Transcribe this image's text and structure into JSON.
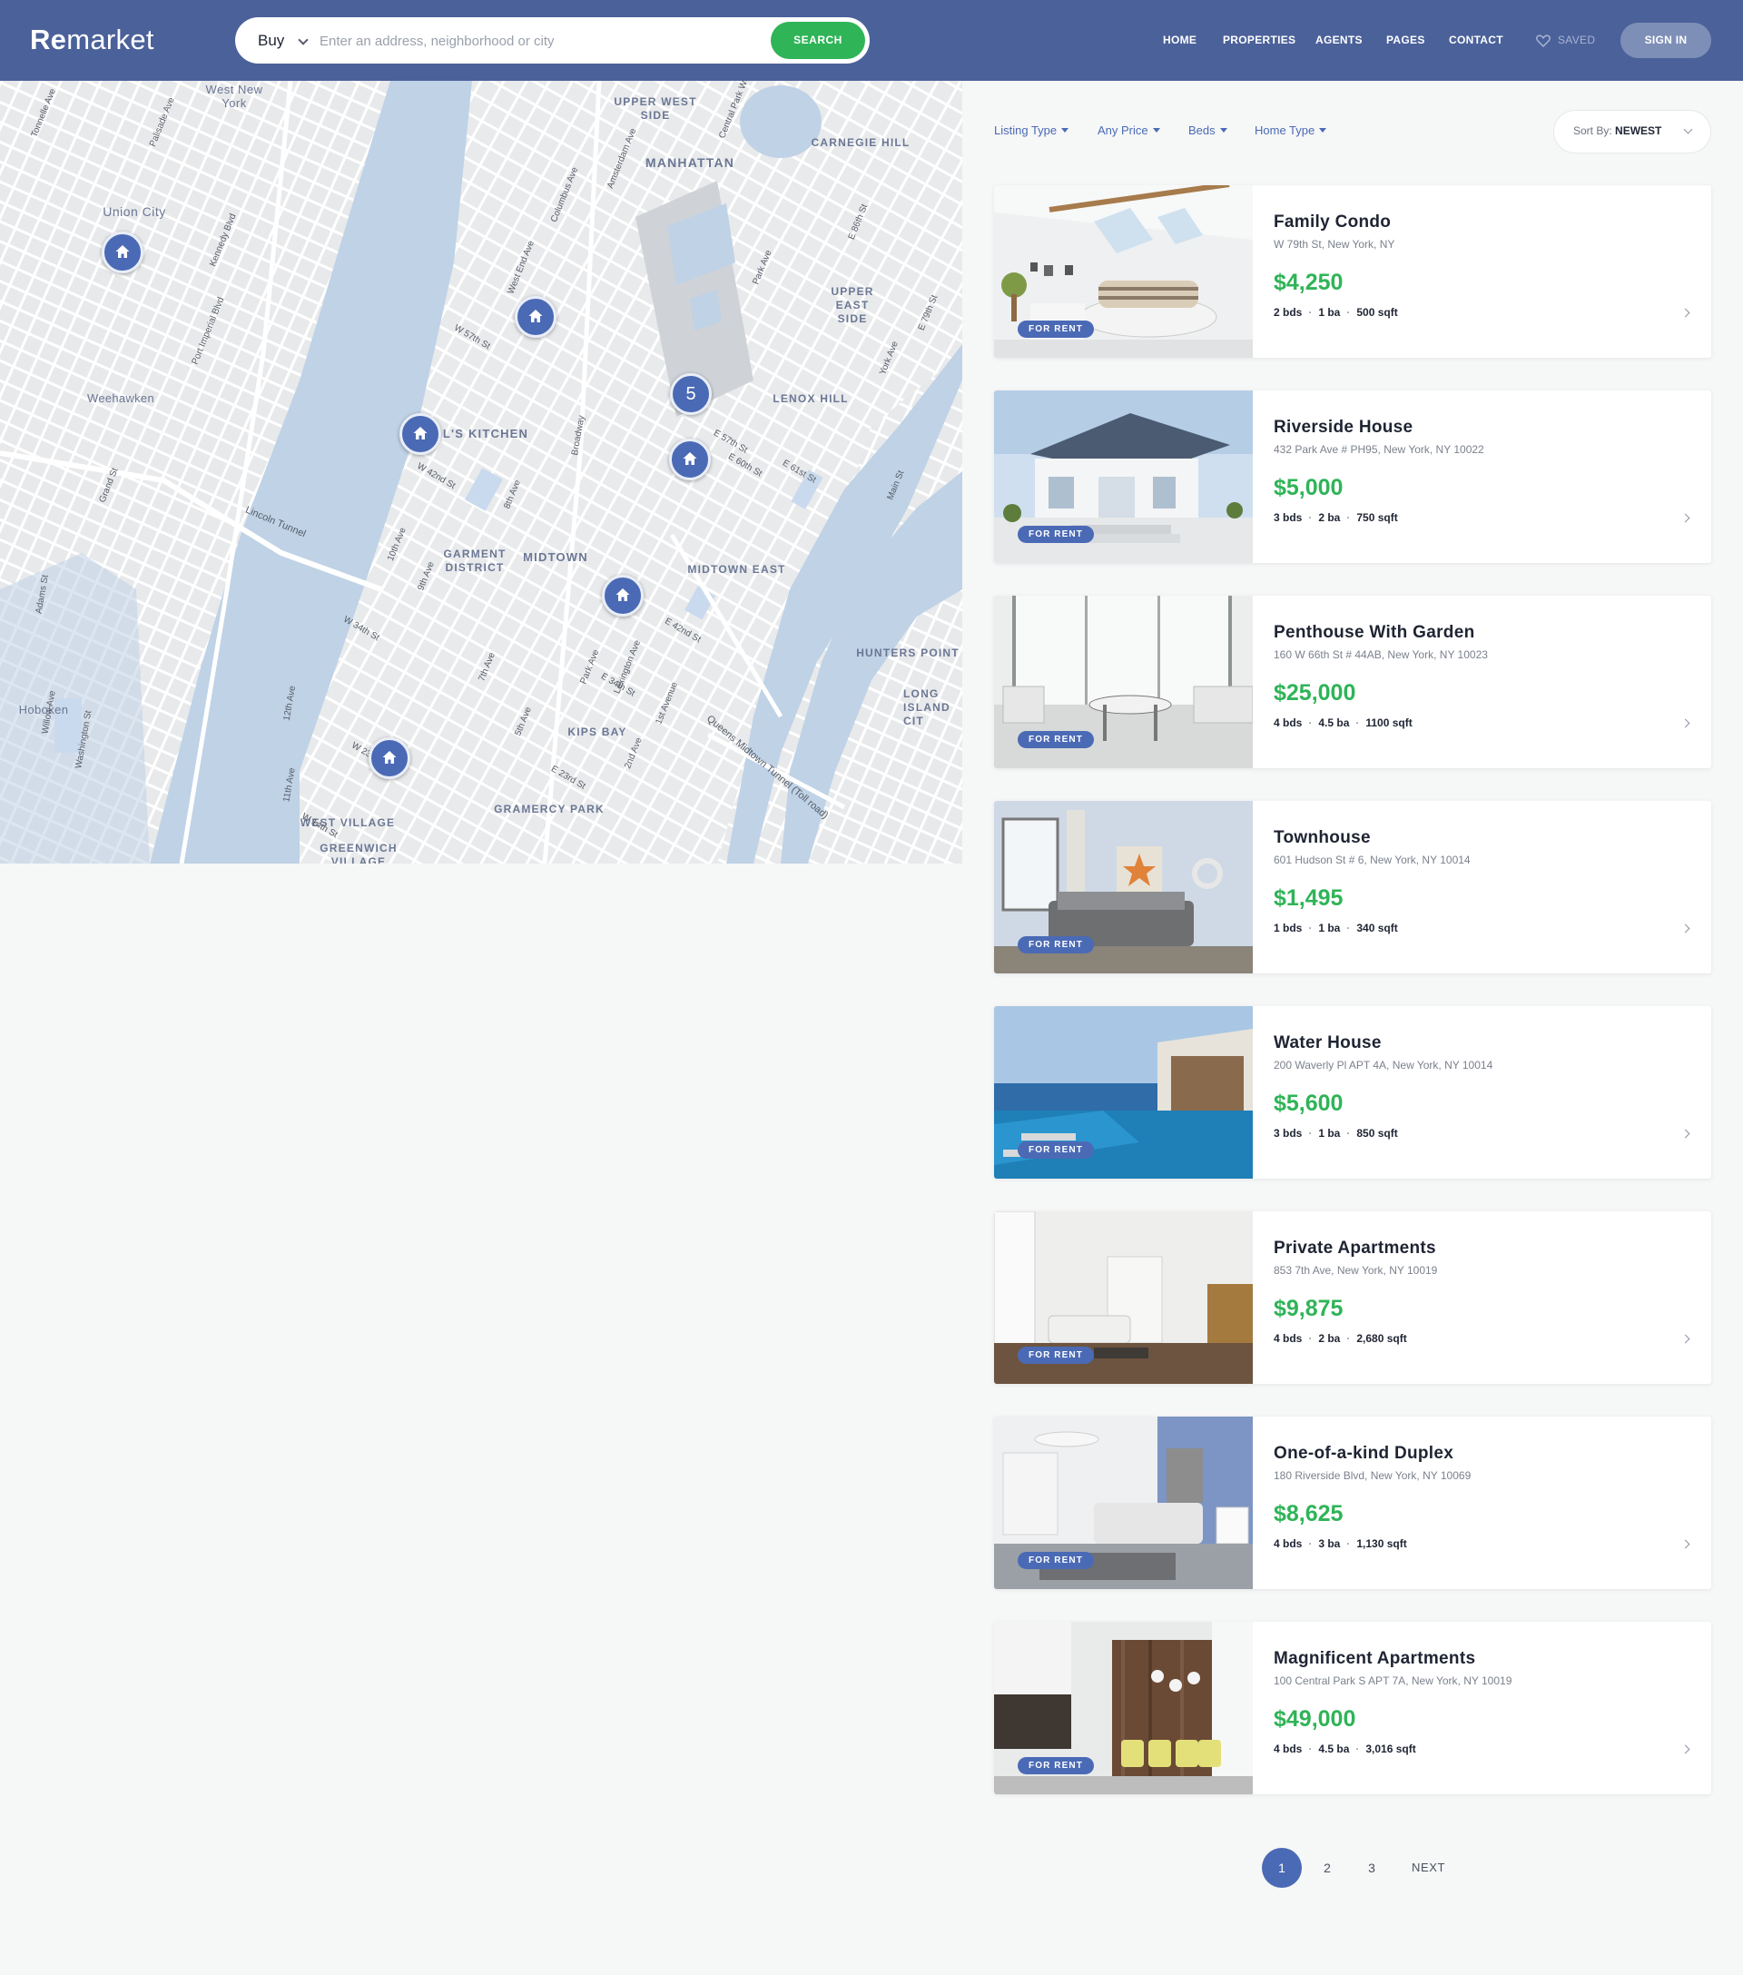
{
  "header": {
    "logo_bold": "Re",
    "logo_rest": "market",
    "search": {
      "type": "Buy",
      "placeholder": "Enter an address, neighborhood or city",
      "button": "SEARCH"
    },
    "nav": [
      "HOME",
      "PROPERTIES",
      "AGENTS",
      "PAGES",
      "CONTACT"
    ],
    "saved": "SAVED",
    "signin": "SIGN IN"
  },
  "map": {
    "neighborhoods": [
      "West New York",
      "UPPER WEST SIDE",
      "MANHATTAN",
      "CARNEGIE HILL",
      "Union City",
      "UPPER EAST SIDE",
      "Weehawken",
      "L'S KITCHEN",
      "LENOX HILL",
      "GARMENT DISTRICT",
      "MIDTOWN",
      "MIDTOWN EAST",
      "HUNTERS POINT",
      "LONG ISLAND CIT",
      "Hoboken",
      "KIPS BAY",
      "GRAMERCY PARK",
      "WEST VILLAGE",
      "GREENWICH VILLAGE"
    ],
    "streets": [
      "Lincoln Tunnel",
      "Queens Midtown Tunnel (Toll road)",
      "12th Ave",
      "11th Ave",
      "10th Ave",
      "9th Ave",
      "8th Ave",
      "7th Ave",
      "5th Ave",
      "Park Ave",
      "Lexington Ave",
      "2nd Ave",
      "1st Avenue",
      "Broadway",
      "W 42nd St",
      "W 34th St",
      "W 23rd St",
      "W 14th St",
      "E 42nd St",
      "E 23rd St",
      "E 34th St",
      "E 57th St",
      "W 57th St",
      "E 79th St",
      "E 86th St",
      "E 61st St",
      "E 60th St",
      "Park Ave",
      "York Ave",
      "West End Ave",
      "Amsterdam Ave",
      "Columbus Ave",
      "Central Park West",
      "Tonnelle Ave",
      "Palisade Ave",
      "Kennedy Blvd",
      "Port Imperial Blvd",
      "Washington St",
      "Willow Ave",
      "Adams St",
      "Grand St",
      "Main St"
    ],
    "markers": [
      {
        "type": "home-icon"
      },
      {
        "type": "home-icon"
      },
      {
        "type": "home-icon"
      },
      {
        "type": "cluster",
        "count": "5"
      },
      {
        "type": "home-icon"
      },
      {
        "type": "home-icon"
      },
      {
        "type": "home-icon"
      }
    ]
  },
  "filters": {
    "items": [
      "Listing Type",
      "Any Price",
      "Beds",
      "Home Type"
    ],
    "sort_label": "Sort By:",
    "sort_value": "NEWEST"
  },
  "listings": [
    {
      "title": "Family Condo",
      "address": "W 79th St, New York, NY",
      "price": "$4,250",
      "beds": "2 bds",
      "baths": "1 ba",
      "sqft": "500 sqft",
      "badge": "FOR RENT"
    },
    {
      "title": "Riverside House",
      "address": "432 Park Ave # PH95, New York, NY 10022",
      "price": "$5,000",
      "beds": "3 bds",
      "baths": "2 ba",
      "sqft": "750 sqft",
      "badge": "FOR RENT"
    },
    {
      "title": "Penthouse With Garden",
      "address": "160 W 66th St # 44AB, New York, NY 10023",
      "price": "$25,000",
      "beds": "4 bds",
      "baths": "4.5 ba",
      "sqft": "1100 sqft",
      "badge": "FOR RENT"
    },
    {
      "title": "Townhouse",
      "address": "601 Hudson St # 6, New York, NY 10014",
      "price": "$1,495",
      "beds": "1 bds",
      "baths": "1 ba",
      "sqft": "340 sqft",
      "badge": "FOR RENT"
    },
    {
      "title": "Water House",
      "address": "200 Waverly Pl APT 4A, New York, NY 10014",
      "price": "$5,600",
      "beds": "3 bds",
      "baths": "1 ba",
      "sqft": "850 sqft",
      "badge": "FOR RENT"
    },
    {
      "title": "Private Apartments",
      "address": "853 7th Ave, New York, NY 10019",
      "price": "$9,875",
      "beds": "4 bds",
      "baths": "2 ba",
      "sqft": "2,680 sqft",
      "badge": "FOR RENT"
    },
    {
      "title": "One-of-a-kind Duplex",
      "address": "180 Riverside Blvd, New York, NY 10069",
      "price": "$8,625",
      "beds": "4 bds",
      "baths": "3 ba",
      "sqft": "1,130 sqft",
      "badge": "FOR RENT"
    },
    {
      "title": "Magnificent Apartments",
      "address": "100 Central Park S APT 7A, New York, NY 10019",
      "price": "$49,000",
      "beds": "4 bds",
      "baths": "4.5 ba",
      "sqft": "3,016 sqft",
      "badge": "FOR RENT"
    }
  ],
  "pagination": {
    "pages": [
      "1",
      "2",
      "3"
    ],
    "current": "1",
    "next": "NEXT"
  },
  "colors": {
    "header": "#4b619a",
    "accent": "#4b6ab5",
    "price": "#2fb457",
    "search_button": "#2fb457",
    "map_water": "#bfd2e6",
    "page_background": "#f6f7f7"
  }
}
